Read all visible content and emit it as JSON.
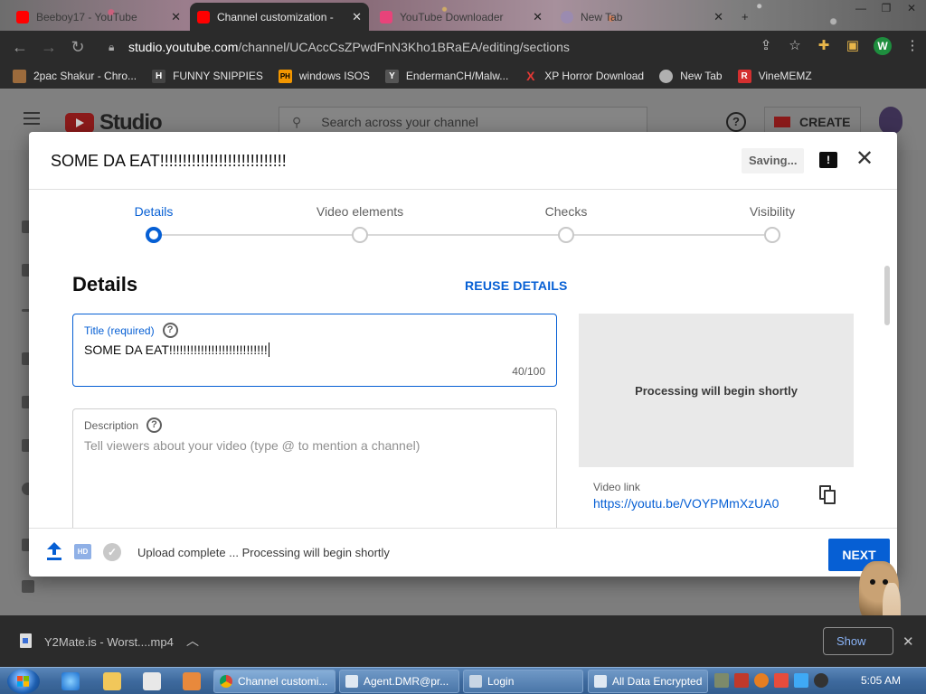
{
  "browser": {
    "tabs": [
      {
        "label": "Beeboy17 - YouTube",
        "active": false
      },
      {
        "label": "Channel customization -",
        "active": true
      },
      {
        "label": "YouTube Downloader",
        "active": false
      },
      {
        "label": "New Tab",
        "active": false
      }
    ],
    "url": {
      "domain": "studio.youtube.com",
      "path": "/channel/UCAccCsZPwdFnN3Kho1BRaEA/editing/sections"
    },
    "profile_initial": "W",
    "bookmarks": [
      {
        "label": "2pac Shakur - Chro...",
        "icon_text": "",
        "icon": "tupac-icon",
        "color": "#9c6b3c"
      },
      {
        "label": "FUNNY SNIPPIES",
        "icon_text": "H",
        "icon": "h-icon",
        "color": "#444444"
      },
      {
        "label": "windows ISOS",
        "icon_text": "PH",
        "icon": "ph-icon",
        "color": "#f29600"
      },
      {
        "label": "EndermanCH/Malw...",
        "icon_text": "Y",
        "icon": "yp-icon",
        "color": "#555555"
      },
      {
        "label": "XP Horror Download",
        "icon_text": "X",
        "icon": "x-icon",
        "color": "#d32f2f"
      },
      {
        "label": "New Tab",
        "icon_text": "",
        "icon": "globe-icon",
        "color": "#b0b0b0"
      },
      {
        "label": "VineMEMZ",
        "icon_text": "R",
        "icon": "r-icon",
        "color": "#d32f2f"
      }
    ]
  },
  "studio": {
    "logo_text": "Studio",
    "search_placeholder": "Search across your channel",
    "create_label": "CREATE"
  },
  "modal": {
    "title": "SOME DA EAT!!!!!!!!!!!!!!!!!!!!!!!!!!!!",
    "saving_label": "Saving...",
    "steps": [
      "Details",
      "Video elements",
      "Checks",
      "Visibility"
    ],
    "active_step": 0,
    "section_title": "Details",
    "reuse_label": "REUSE DETAILS",
    "title_field": {
      "label": "Title (required)",
      "value": "SOME DA EAT!!!!!!!!!!!!!!!!!!!!!!!!!!!!",
      "count": "40/100"
    },
    "description_field": {
      "label": "Description",
      "placeholder": "Tell viewers about your video (type @ to mention a channel)"
    },
    "preview_text": "Processing will begin shortly",
    "video_link_label": "Video link",
    "video_link": "https://youtu.be/VOYPMmXzUA0",
    "footer_status": "Upload complete ... Processing will begin shortly",
    "next_label": "NEXT",
    "hd_badge": "HD"
  },
  "downloads": {
    "file": "Y2Mate.is - Worst....mp4",
    "show_all_label": "Show"
  },
  "taskbar": {
    "windows": [
      {
        "label": "Channel customi...",
        "icon": "chrome-icon"
      },
      {
        "label": "Agent.DMR@pr...",
        "icon": "window-icon"
      },
      {
        "label": "Login",
        "icon": "login-icon"
      },
      {
        "label": "All Data Encrypted",
        "icon": "window-icon"
      }
    ],
    "clock": "5:05 AM"
  },
  "colors": {
    "accent": "#065fd4",
    "youtube_red": "#ff0000"
  }
}
